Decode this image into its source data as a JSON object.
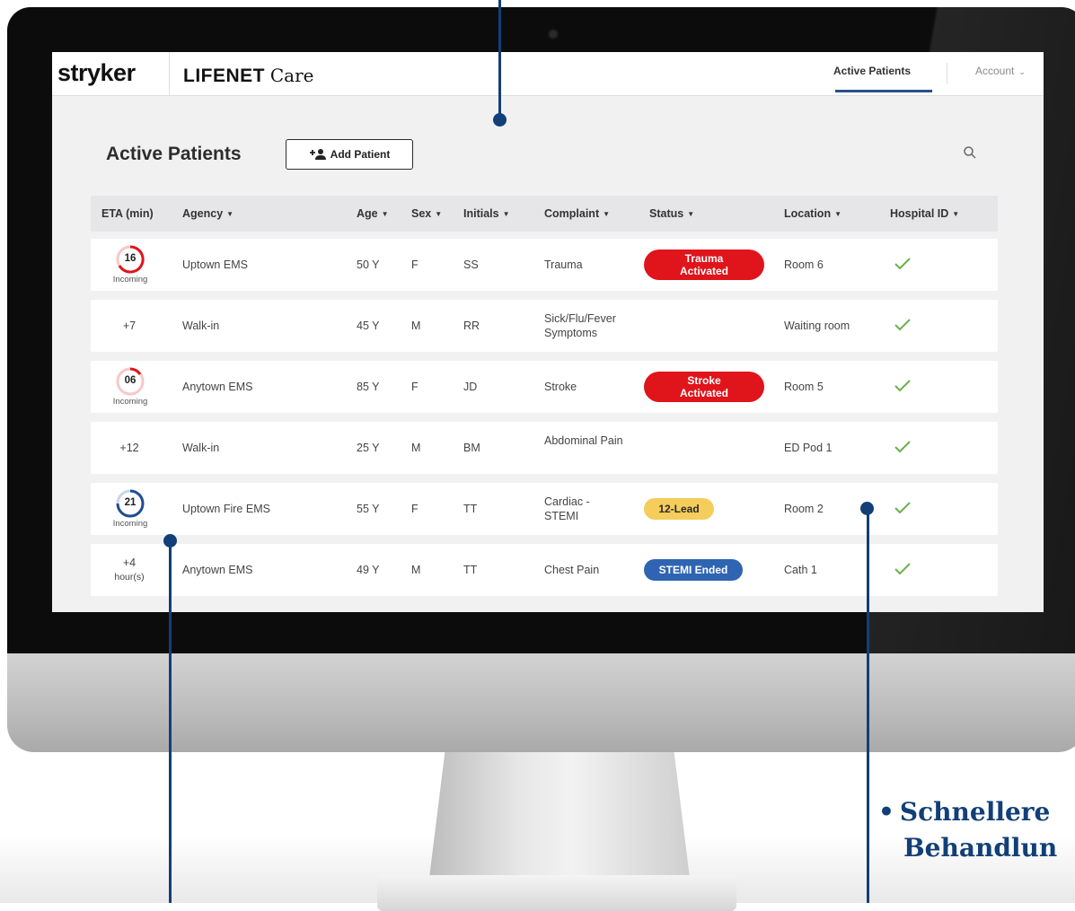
{
  "header": {
    "brand": "stryker",
    "product_bold": "LIFENET",
    "product_light": "Care",
    "nav_active": "Active Patients",
    "nav_account": "Account"
  },
  "page": {
    "title": "Active Patients",
    "add_button": "Add Patient"
  },
  "table": {
    "columns": [
      "ETA (min)",
      "Agency",
      "Age",
      "Sex",
      "Initials",
      "Complaint",
      "Status",
      "Location",
      "Hospital ID"
    ],
    "rows": [
      {
        "eta": "16",
        "eta_label": "Incoming",
        "agency": "Uptown EMS",
        "age": "50 Y",
        "sex": "F",
        "initials": "SS",
        "complaint": "Trauma",
        "status": "Trauma Activated",
        "location": "Room 6"
      },
      {
        "eta": "+7",
        "agency": "Walk-in",
        "age": "45 Y",
        "sex": "M",
        "initials": "RR",
        "complaint": "Sick/Flu/Fever Symptoms",
        "status": "",
        "location": "Waiting room"
      },
      {
        "eta": "06",
        "eta_label": "Incoming",
        "agency": "Anytown EMS",
        "age": "85 Y",
        "sex": "F",
        "initials": "JD",
        "complaint": "Stroke",
        "status": "Stroke Activated",
        "location": "Room 5"
      },
      {
        "eta": "+12",
        "agency": "Walk-in",
        "age": "25 Y",
        "sex": "M",
        "initials": "BM",
        "complaint": "Abdominal Pain",
        "status": "",
        "location": "ED Pod 1"
      },
      {
        "eta": "21",
        "eta_label": "Incoming",
        "agency": "Uptown Fire EMS",
        "age": "55 Y",
        "sex": "F",
        "initials": "TT",
        "complaint": "Cardiac - STEMI",
        "status": "12-Lead",
        "location": "Room 2"
      },
      {
        "eta": "+4",
        "eta_label": "hour(s)",
        "agency": "Anytown EMS",
        "age": "49 Y",
        "sex": "M",
        "initials": "TT",
        "complaint": "Chest Pain",
        "status": "STEMI Ended",
        "location": "Cath 1"
      }
    ]
  },
  "footer_text": {
    "line1": "Schnellere",
    "line2": "Behandlun"
  },
  "colors": {
    "status_red": "#e0141b",
    "status_yellow": "#f5cd5b",
    "status_blue": "#2e64b2",
    "check_green": "#6ab04c",
    "callout_navy": "#123f77",
    "nav_underline": "#2b4f86"
  },
  "icons": [
    "add-person-icon",
    "search-icon",
    "chevron-down-icon",
    "sort-caret-icon",
    "checkmark-icon",
    "eta-ring-icon"
  ]
}
